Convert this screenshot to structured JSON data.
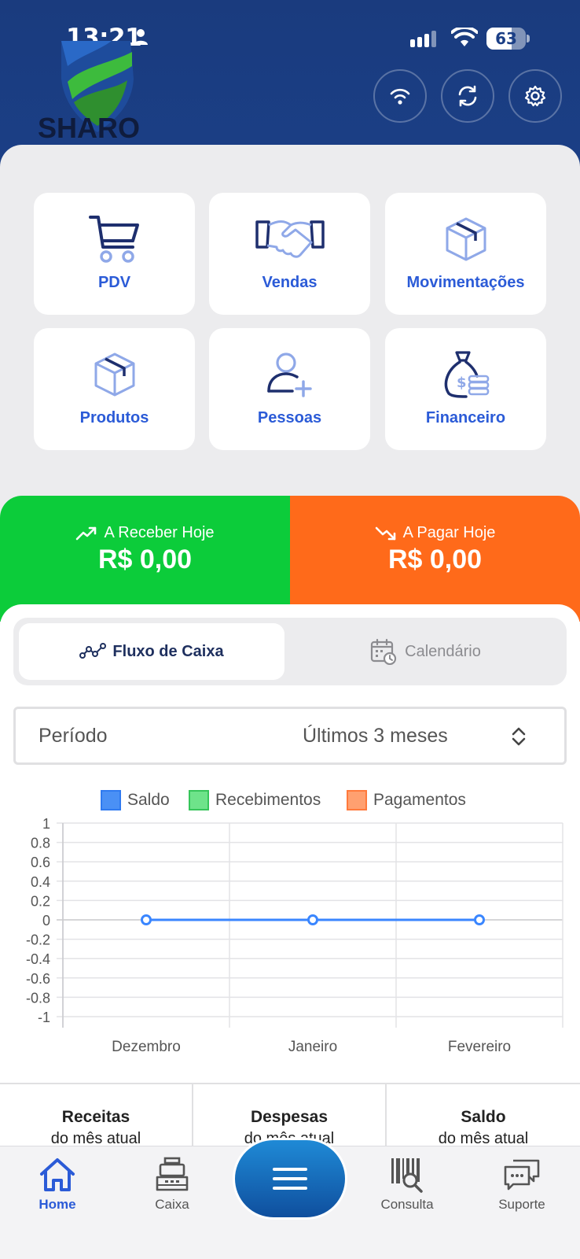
{
  "status_bar": {
    "time": "13:21",
    "battery": "63",
    "battery_level": 0.63
  },
  "brand": {
    "logo_text": "SHARO"
  },
  "header_buttons": [
    {
      "icon": "wifi-icon"
    },
    {
      "icon": "sync-icon"
    },
    {
      "icon": "gear-icon"
    }
  ],
  "menu": {
    "pdv": "PDV",
    "vendas": "Vendas",
    "movimentacoes": "Movimentações",
    "produtos": "Produtos",
    "pessoas": "Pessoas",
    "financeiro": "Financeiro"
  },
  "summary": {
    "receive_title": "A Receber Hoje",
    "receive_value": "R$ 0,00",
    "pay_title": "A Pagar Hoje",
    "pay_value": "R$ 0,00",
    "receive_color": "#0ccc3a",
    "pay_color": "#ff6a1a"
  },
  "tabs": {
    "cashflow": "Fluxo de Caixa",
    "calendar": "Calendário"
  },
  "period": {
    "label": "Período",
    "value": "Últimos 3 meses"
  },
  "chart_data": {
    "type": "line",
    "categories": [
      "Dezembro",
      "Janeiro",
      "Fevereiro"
    ],
    "series": [
      {
        "name": "Saldo",
        "values": [
          0,
          0,
          0
        ],
        "color": "#3a86ff"
      },
      {
        "name": "Recebimentos",
        "values": [],
        "color": "#49d36b"
      },
      {
        "name": "Pagamentos",
        "values": [],
        "color": "#ff8a4c"
      }
    ],
    "yticks": [
      "1",
      "0.8",
      "0.6",
      "0.4",
      "0.2",
      "0",
      "-0.2",
      "-0.4",
      "-0.6",
      "-0.8",
      "-1"
    ],
    "ylim": [
      -1,
      1
    ],
    "grid": true,
    "legend": "top-center"
  },
  "stats": [
    {
      "title": "Receitas",
      "subtitle": "do mês atual"
    },
    {
      "title": "Despesas",
      "subtitle": "do mês atual"
    },
    {
      "title": "Saldo",
      "subtitle": "do mês atual"
    }
  ],
  "nav": {
    "home": "Home",
    "caixa": "Caixa",
    "consulta": "Consulta",
    "suporte": "Suporte"
  },
  "colors": {
    "primary": "#1b3f86",
    "accent": "#2b5bd7"
  }
}
